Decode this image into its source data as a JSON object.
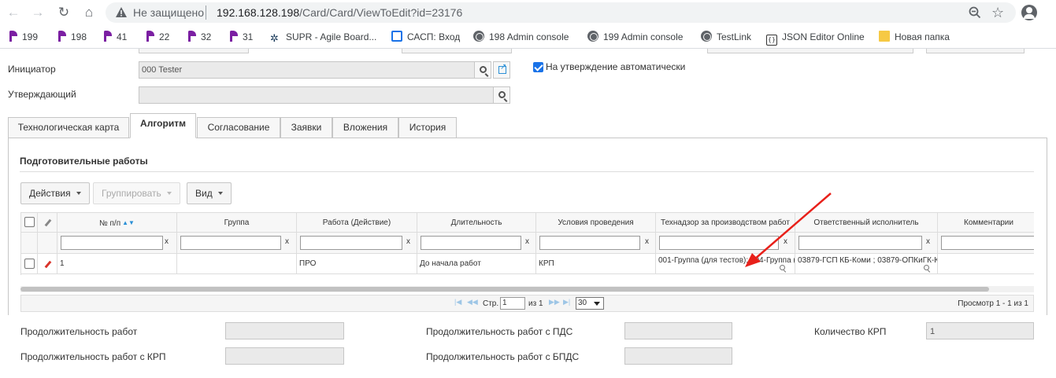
{
  "browser": {
    "not_secure": "Не защищено",
    "url_host": "192.168.128.198",
    "url_path": "/Card/Card/ViewToEdit?id=23176",
    "bookmarks": [
      {
        "label": "199",
        "icon": "purple-pen-icon"
      },
      {
        "label": "198",
        "icon": "purple-pen-icon"
      },
      {
        "label": "41",
        "icon": "purple-pen-icon"
      },
      {
        "label": "22",
        "icon": "purple-pen-icon"
      },
      {
        "label": "32",
        "icon": "purple-pen-icon"
      },
      {
        "label": "31",
        "icon": "purple-pen-icon"
      },
      {
        "label": "SUPR - Agile Board...",
        "icon": "agile-icon"
      },
      {
        "label": "САСП: Вход",
        "icon": "sasp-icon"
      },
      {
        "label": "198 Admin console",
        "icon": "globe-icon"
      },
      {
        "label": "199 Admin console",
        "icon": "globe-icon"
      },
      {
        "label": "TestLink",
        "icon": "globe-icon"
      },
      {
        "label": "JSON Editor Online",
        "icon": "json-icon"
      },
      {
        "label": "Новая папка",
        "icon": "folder-icon"
      }
    ]
  },
  "form": {
    "initiator_label": "Инициатор",
    "initiator_value": "000 Tester",
    "approver_label": "Утверждающий",
    "approver_value": "",
    "auto_approve_label": "На утверждение автоматически",
    "auto_approve_checked": true
  },
  "tabs": [
    {
      "label": "Технологическая карта",
      "active": false
    },
    {
      "label": "Алгоритм",
      "active": true
    },
    {
      "label": "Согласование",
      "active": false
    },
    {
      "label": "Заявки",
      "active": false
    },
    {
      "label": "Вложения",
      "active": false
    },
    {
      "label": "История",
      "active": false
    }
  ],
  "section": {
    "title": "Подготовительные работы"
  },
  "toolbar": {
    "actions_label": "Действия",
    "group_label": "Группировать",
    "view_label": "Вид"
  },
  "grid": {
    "columns": [
      "№ п/п",
      "Группа",
      "Работа (Действие)",
      "Длительность",
      "Условия проведения",
      "Технадзор за производством работ",
      "Ответственный исполнитель",
      "Комментарии"
    ],
    "filter_clear": "x",
    "rows": [
      {
        "num": "1",
        "group": "",
        "work": "ПРО",
        "duration": "До начала работ",
        "conditions": "КРП",
        "supervision": "001-Группа (для тестов); 004-Группа (д",
        "executor": "03879-ГСП КБ-Коми ; 03879-ОПКиГК-К",
        "comment": ""
      }
    ]
  },
  "pager": {
    "page_label": "Стр.",
    "page_value": "1",
    "of_label": "из 1",
    "page_size": "30",
    "summary": "Просмотр 1 - 1 из 1"
  },
  "summary": {
    "duration_label": "Продолжительность работ",
    "duration_value": "",
    "duration_krp_label": "Продолжительность работ с КРП",
    "duration_krp_value": "",
    "duration_pds_label": "Продолжительность работ с ПДС",
    "duration_pds_value": "",
    "duration_bpds_label": "Продолжительность работ с БПДС",
    "duration_bpds_value": "",
    "krp_count_label": "Количество КРП",
    "krp_count_value": "1"
  },
  "colors": {
    "annotation_arrow": "#e8201a",
    "accent": "#1a73e8",
    "pencil": "#d9342b"
  }
}
